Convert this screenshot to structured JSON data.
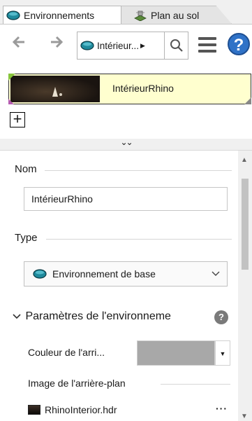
{
  "tabs": [
    {
      "label": "Environnements",
      "icon": "environment-icon",
      "active": true
    },
    {
      "label": "Plan au sol",
      "icon": "ground-plane-icon",
      "active": false
    }
  ],
  "toolbar": {
    "back_icon": "back-arrow-icon",
    "forward_icon": "forward-arrow-icon",
    "breadcrumb_label": "Intérieur...",
    "breadcrumb_icon": "environment-icon",
    "search_icon": "search-icon",
    "menu_icon": "menu-icon",
    "help_icon": "help-icon",
    "help_glyph": "?"
  },
  "environment_list": {
    "items": [
      {
        "name": "IntérieurRhino",
        "selected": true
      }
    ],
    "add_glyph": "+"
  },
  "properties": {
    "name_group_label": "Nom",
    "name_value": "IntérieurRhino",
    "type_group_label": "Type",
    "type_value": "Environnement de base",
    "section_title": "Paramètres de l'environneme",
    "section_help_glyph": "?",
    "background_color_label": "Couleur de l'arri...",
    "background_color": "#a8a8a8",
    "background_image_label": "Image de l'arrière-plan",
    "background_image_file": "RhinoInterior.hdr",
    "more_glyph": "···"
  },
  "colors": {
    "selected_item_bg": "#ffffcf",
    "help_blue": "#2f72c7"
  }
}
